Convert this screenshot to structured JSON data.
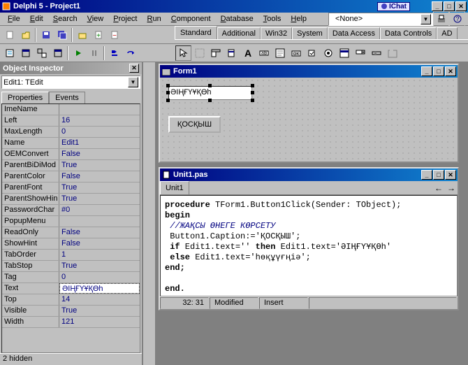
{
  "app": {
    "title": "Delphi 5 - Project1",
    "ichat_badge": "IChat"
  },
  "menu": {
    "file": "File",
    "edit": "Edit",
    "search": "Search",
    "view": "View",
    "project": "Project",
    "run": "Run",
    "component": "Component",
    "database": "Database",
    "tools": "Tools",
    "help": "Help"
  },
  "library_combo": "<None>",
  "palette_tabs": [
    "Standard",
    "Additional",
    "Win32",
    "System",
    "Data Access",
    "Data Controls",
    "AD"
  ],
  "objinsp": {
    "title": "Object Inspector",
    "selector": "Edit1: TEdit",
    "tabs": {
      "properties": "Properties",
      "events": "Events"
    },
    "rows": [
      {
        "name": "ImeName",
        "val": ""
      },
      {
        "name": "Left",
        "val": "16"
      },
      {
        "name": "MaxLength",
        "val": "0"
      },
      {
        "name": "Name",
        "val": "Edit1"
      },
      {
        "name": "OEMConvert",
        "val": "False"
      },
      {
        "name": "ParentBiDiMod",
        "val": "True"
      },
      {
        "name": "ParentColor",
        "val": "False"
      },
      {
        "name": "ParentFont",
        "val": "True"
      },
      {
        "name": "ParentShowHin",
        "val": "True"
      },
      {
        "name": "PasswordChar",
        "val": "#0"
      },
      {
        "name": "PopupMenu",
        "val": ""
      },
      {
        "name": "ReadOnly",
        "val": "False"
      },
      {
        "name": "ShowHint",
        "val": "False"
      },
      {
        "name": "TabOrder",
        "val": "1"
      },
      {
        "name": "TabStop",
        "val": "True"
      },
      {
        "name": "Tag",
        "val": "0"
      },
      {
        "name": "Text",
        "val": "ӘІҢҒҮҰҚӨһ",
        "selected": true
      },
      {
        "name": "Top",
        "val": "14"
      },
      {
        "name": "Visible",
        "val": "True"
      },
      {
        "name": "Width",
        "val": "121"
      }
    ],
    "status": "2 hidden"
  },
  "form_window": {
    "title": "Form1",
    "edit_value": "ӘІҢҒҮҰҚӨһ",
    "button_caption": "ҚОСҚЫШ"
  },
  "code_window": {
    "title": "Unit1.pas",
    "tab": "Unit1",
    "lines": {
      "l1a": "procedure",
      "l1b": " TForm1.Button1Click(Sender: TObject);",
      "l2": "begin",
      "l3": " //ЖАҚСЫ ӨНЕГЕ КӨРСЕТУ",
      "l4": " Button1.Caption:='ҚОСҚЫШ';",
      "l5a": " if",
      "l5b": " Edit1.text='' ",
      "l5c": "then",
      "l5d": " Edit1.text='ӘІҢҒҮҰҚӨһ'",
      "l6a": " else",
      "l6b": " Edit1.text='һөқұүғңіә';",
      "l7": "end;",
      "l8": "",
      "l9": "end."
    },
    "status": {
      "pos": "32: 31",
      "state": "Modified",
      "mode": "Insert"
    }
  }
}
